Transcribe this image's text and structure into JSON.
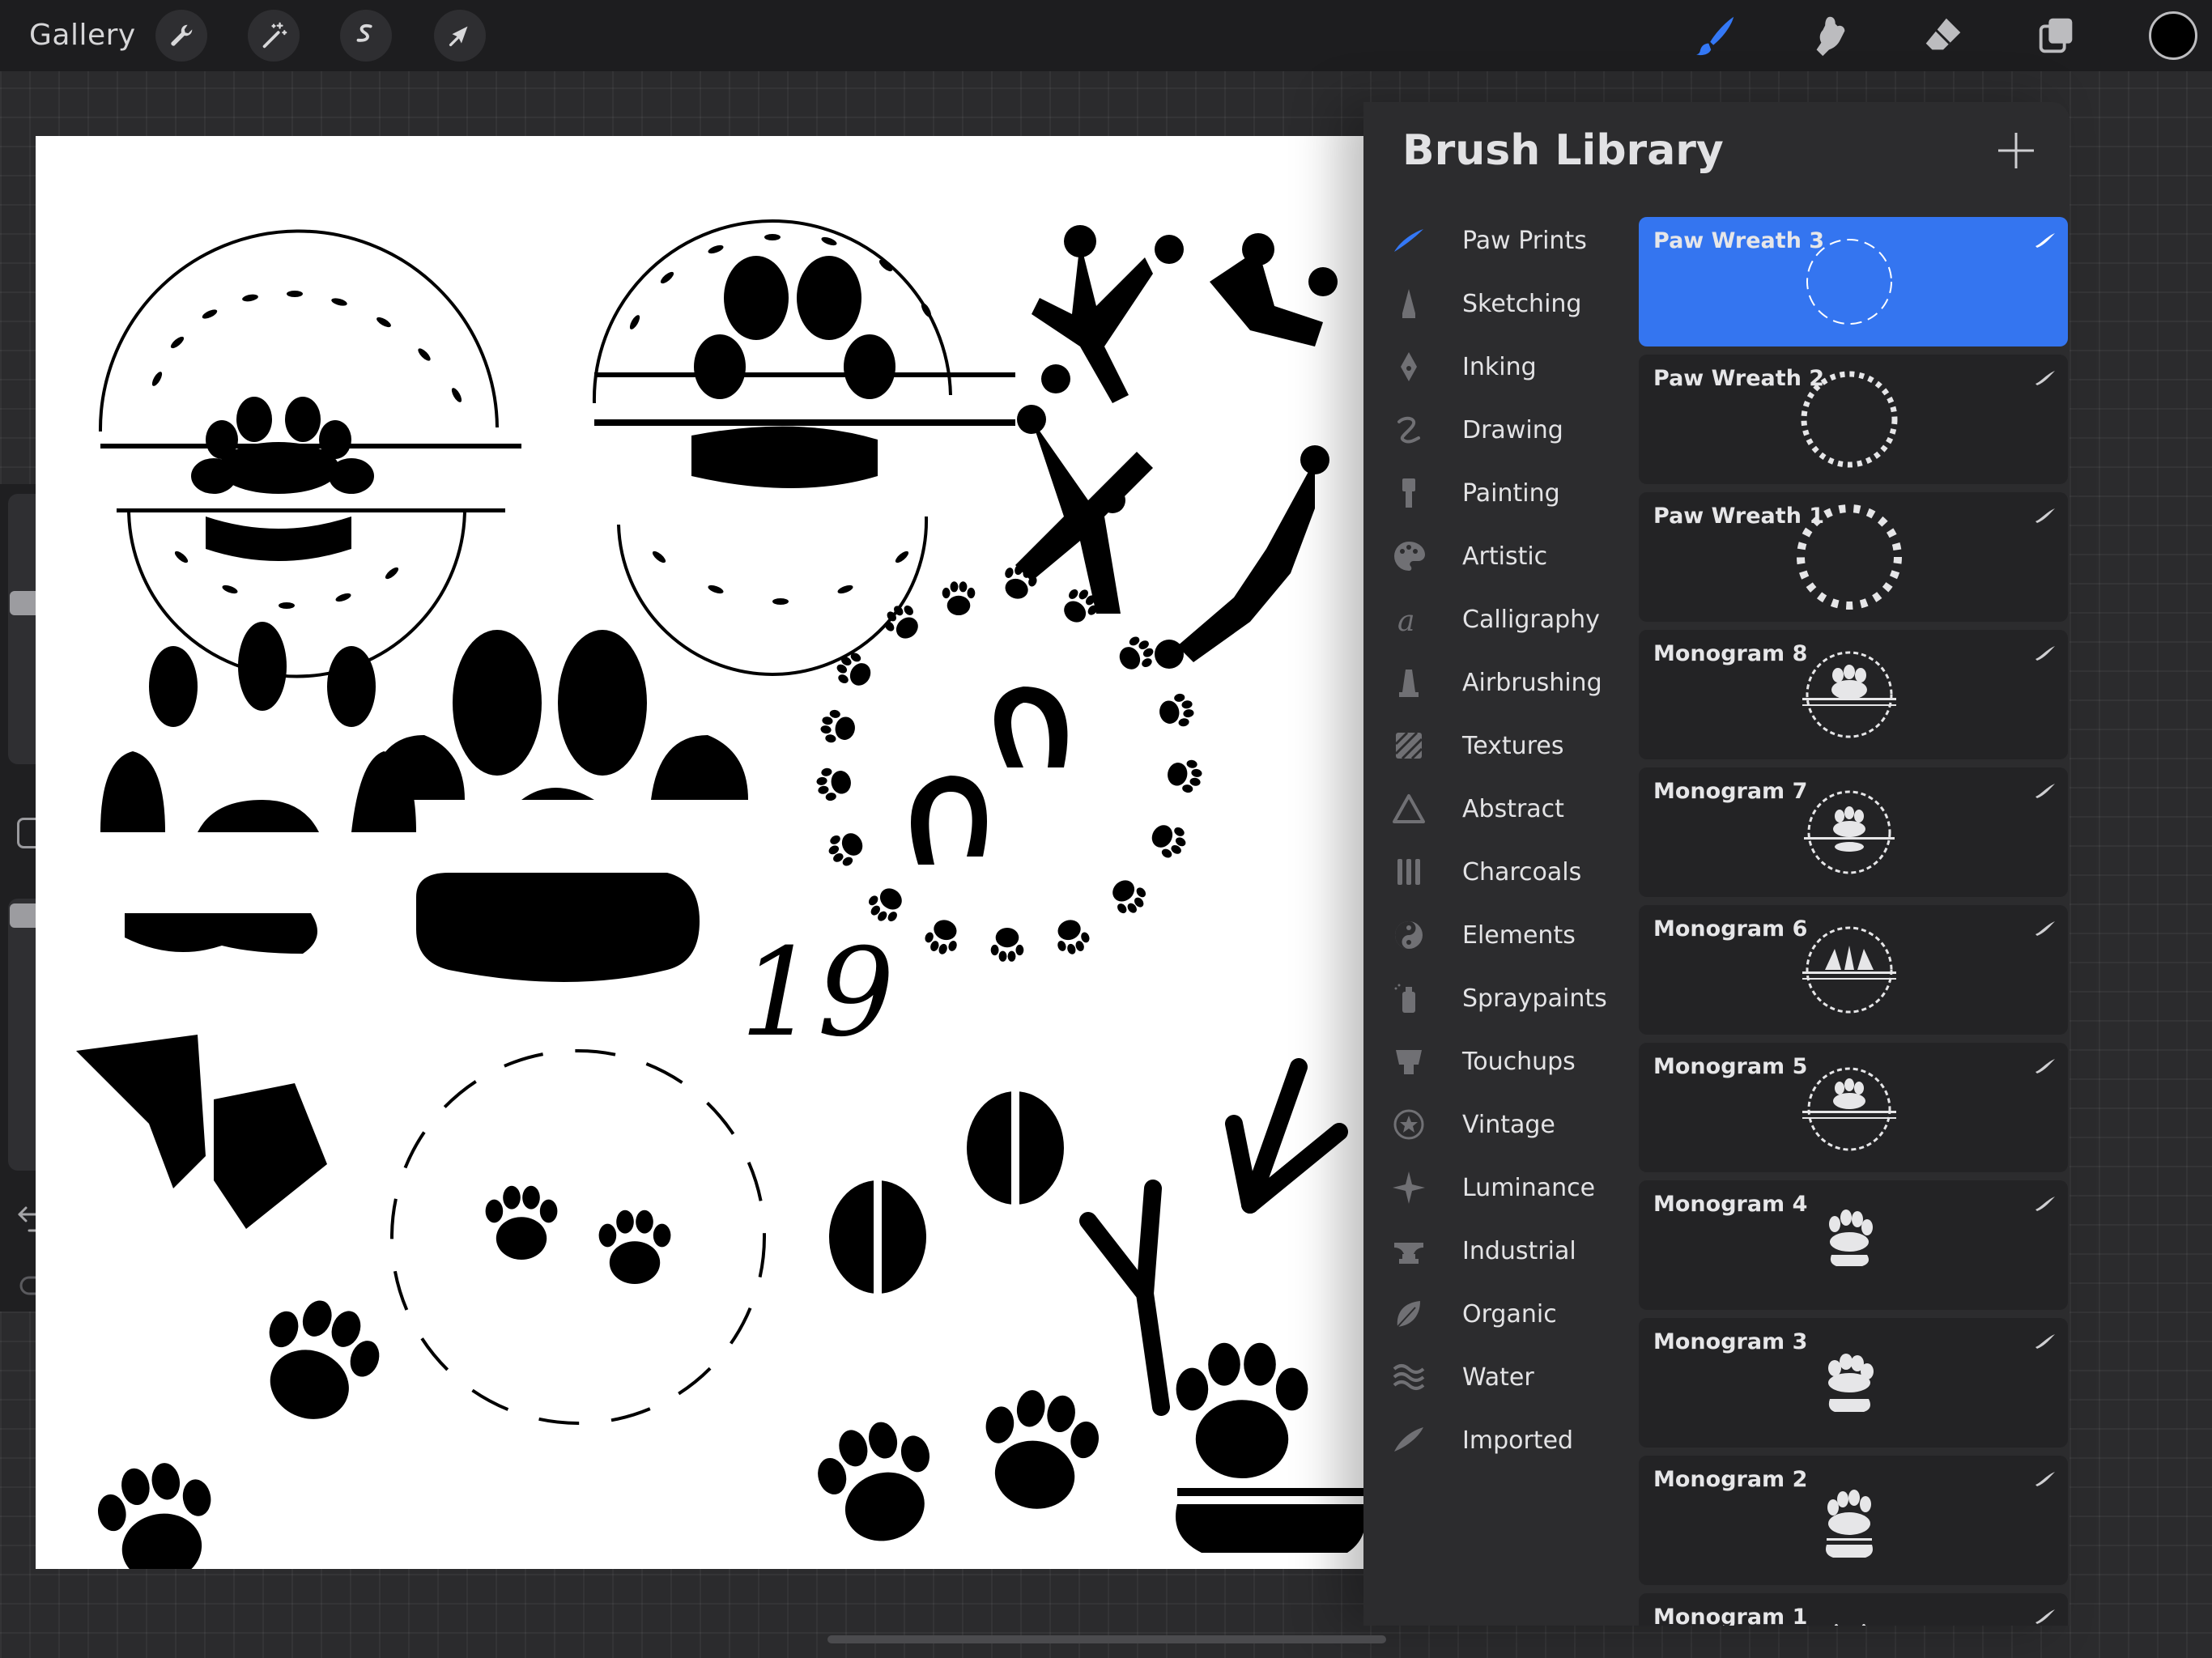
{
  "topbar": {
    "gallery_label": "Gallery",
    "tools": [
      "wrench-icon",
      "magic-wand-icon",
      "selection-icon",
      "transform-arrow-icon"
    ],
    "right_tools": [
      "brush-icon",
      "smudge-icon",
      "eraser-icon",
      "layers-icon"
    ],
    "active_tool": "brush-icon",
    "active_color": "#3478f6",
    "current_color": "#000000"
  },
  "library": {
    "title": "Brush Library",
    "add_icon": "plus-icon",
    "brush_sets": [
      {
        "label": "Paw Prints",
        "icon": "paw-prints-brush-icon"
      },
      {
        "label": "Sketching",
        "icon": "pencil-icon"
      },
      {
        "label": "Inking",
        "icon": "ink-pen-icon"
      },
      {
        "label": "Drawing",
        "icon": "squiggle-icon"
      },
      {
        "label": "Painting",
        "icon": "paintbrush-icon"
      },
      {
        "label": "Artistic",
        "icon": "palette-icon"
      },
      {
        "label": "Calligraphy",
        "icon": "calligraphy-a-icon"
      },
      {
        "label": "Airbrushing",
        "icon": "airbrush-icon"
      },
      {
        "label": "Textures",
        "icon": "texture-icon"
      },
      {
        "label": "Abstract",
        "icon": "triangle-icon"
      },
      {
        "label": "Charcoals",
        "icon": "charcoal-icon"
      },
      {
        "label": "Elements",
        "icon": "yin-yang-icon"
      },
      {
        "label": "Spraypaints",
        "icon": "spray-can-icon"
      },
      {
        "label": "Touchups",
        "icon": "touchup-icon"
      },
      {
        "label": "Vintage",
        "icon": "star-badge-icon"
      },
      {
        "label": "Luminance",
        "icon": "sparkle-icon"
      },
      {
        "label": "Industrial",
        "icon": "anvil-icon"
      },
      {
        "label": "Organic",
        "icon": "leaf-icon"
      },
      {
        "label": "Water",
        "icon": "waves-icon"
      },
      {
        "label": "Imported",
        "icon": "feather-icon"
      }
    ],
    "selected_set": "Paw Prints",
    "brushes": [
      {
        "name": "Paw Wreath 3",
        "selected": true,
        "preview": "leaf-wreath"
      },
      {
        "name": "Paw Wreath 2",
        "selected": false,
        "preview": "dot-wreath"
      },
      {
        "name": "Paw Wreath 1",
        "selected": false,
        "preview": "paw-wreath"
      },
      {
        "name": "Monogram 8",
        "selected": false,
        "preview": "monogram-wreath"
      },
      {
        "name": "Monogram 7",
        "selected": false,
        "preview": "monogram-wreath"
      },
      {
        "name": "Monogram 6",
        "selected": false,
        "preview": "monogram-wreath"
      },
      {
        "name": "Monogram 5",
        "selected": false,
        "preview": "monogram-wreath"
      },
      {
        "name": "Monogram 4",
        "selected": false,
        "preview": "paw-split"
      },
      {
        "name": "Monogram 3",
        "selected": false,
        "preview": "paw-split"
      },
      {
        "name": "Monogram 2",
        "selected": false,
        "preview": "paw-split"
      },
      {
        "name": "Monogram 1",
        "selected": false,
        "preview": "paw-split"
      }
    ]
  },
  "canvas": {
    "number_text": "19"
  }
}
